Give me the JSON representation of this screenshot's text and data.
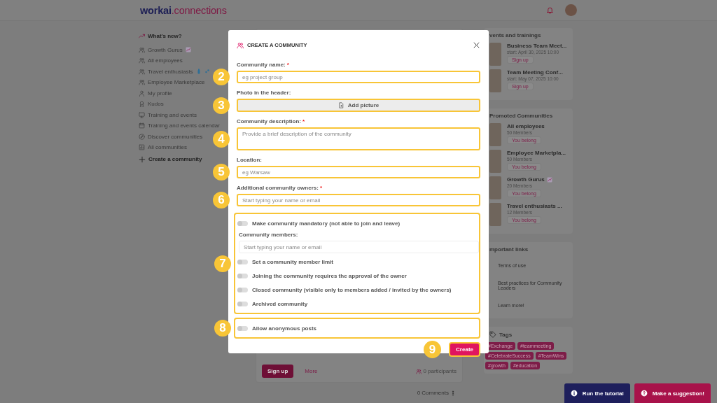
{
  "header": {
    "logo_main": "workai",
    "logo_accent": ".connections"
  },
  "sidebar": {
    "items": [
      {
        "label": "What's new?",
        "selected": true
      },
      {
        "label": "Growth Gurus",
        "selected": false
      },
      {
        "label": "All employees",
        "selected": false
      },
      {
        "label": "Travel enthusiasts",
        "selected": false
      },
      {
        "label": "Employee Marketplace",
        "selected": false
      },
      {
        "label": "My profile",
        "selected": false
      },
      {
        "label": "Kudos",
        "selected": false
      },
      {
        "label": "Training and events",
        "selected": false
      },
      {
        "label": "Training and events calendar",
        "selected": false
      },
      {
        "label": "Discover communities",
        "selected": false
      },
      {
        "label": "All communities",
        "selected": false
      }
    ],
    "create_link": "Create a community"
  },
  "feed": {
    "signup": "Sign up",
    "more": "More",
    "participants": "0 participants",
    "comments": "0 Comments"
  },
  "events": {
    "title": "vents and trainings",
    "items": [
      {
        "title": "Business Team Meet...",
        "start": "start: April 30, 2025 10:00",
        "action": "Sign up"
      },
      {
        "title": "Team Meeting Conf...",
        "start": "start: May 07, 2025 10:00",
        "action": "Sign up"
      }
    ]
  },
  "promoted": {
    "title": "Promoted Communities",
    "items": [
      {
        "name": "All employees",
        "members": "50 Members",
        "status": "You belong"
      },
      {
        "name": "Employee Marketpla...",
        "members": "50 Members",
        "status": "You belong"
      },
      {
        "name": "Growth Gurus",
        "members": "20 Members",
        "status": "You belong"
      },
      {
        "name": "Travel enthusiasts ...",
        "members": "12 Members",
        "status": "You belong"
      }
    ]
  },
  "links": {
    "title": "mportant links",
    "items": [
      "Terms of use",
      "Best practices for Community Leaders",
      "Learn more!"
    ]
  },
  "tags": {
    "title": "Tags",
    "items": [
      "#Exchange",
      "#teammeeting",
      "#CelebrateSuccess",
      "#TeamWins",
      "#growth",
      "#education"
    ]
  },
  "modal": {
    "title": "CREATE A COMMUNITY",
    "fields": [
      {
        "kind": "text",
        "label": "Community name:",
        "required_mark": "*",
        "placeholder": "eg project group",
        "marker": "2"
      },
      {
        "kind": "upload",
        "label": "Photo in the header:",
        "button": "Add picture",
        "marker": "3"
      },
      {
        "kind": "textarea",
        "label": "Community description:",
        "required_mark": "*",
        "placeholder": "Provide a brief description of the community",
        "marker": "4"
      },
      {
        "kind": "text",
        "label": "Location:",
        "placeholder": "eg Warsaw",
        "marker": "5"
      },
      {
        "kind": "text",
        "label": "Additional community owners:",
        "required_mark": "*",
        "placeholder": "Start typing your name or email",
        "marker": "6"
      }
    ],
    "groups": [
      {
        "marker": "7",
        "items": [
          {
            "kind": "toggle",
            "label": "Make community mandatory (not able to join and leave)",
            "on": false
          },
          {
            "kind": "field",
            "label": "Community members:",
            "placeholder": "Start typing your name or email"
          },
          {
            "kind": "toggle",
            "label": "Set a community member limit",
            "on": false
          },
          {
            "kind": "toggle",
            "label": "Joining the community requires the approval of the owner",
            "on": false
          },
          {
            "kind": "toggle",
            "label": "Closed community (visible only to members added / invited by the owners)",
            "on": false
          },
          {
            "kind": "toggle",
            "label": "Archived community",
            "on": false
          }
        ]
      },
      {
        "marker": "8",
        "items": [
          {
            "kind": "toggle",
            "label": "Allow anonymous posts",
            "on": false
          }
        ]
      }
    ],
    "create": {
      "label": "Create",
      "marker": "9"
    }
  },
  "fab": [
    {
      "kind": "info",
      "label": "Run the tutorial"
    },
    {
      "kind": "help",
      "label": "Make a suggestion!"
    }
  ]
}
